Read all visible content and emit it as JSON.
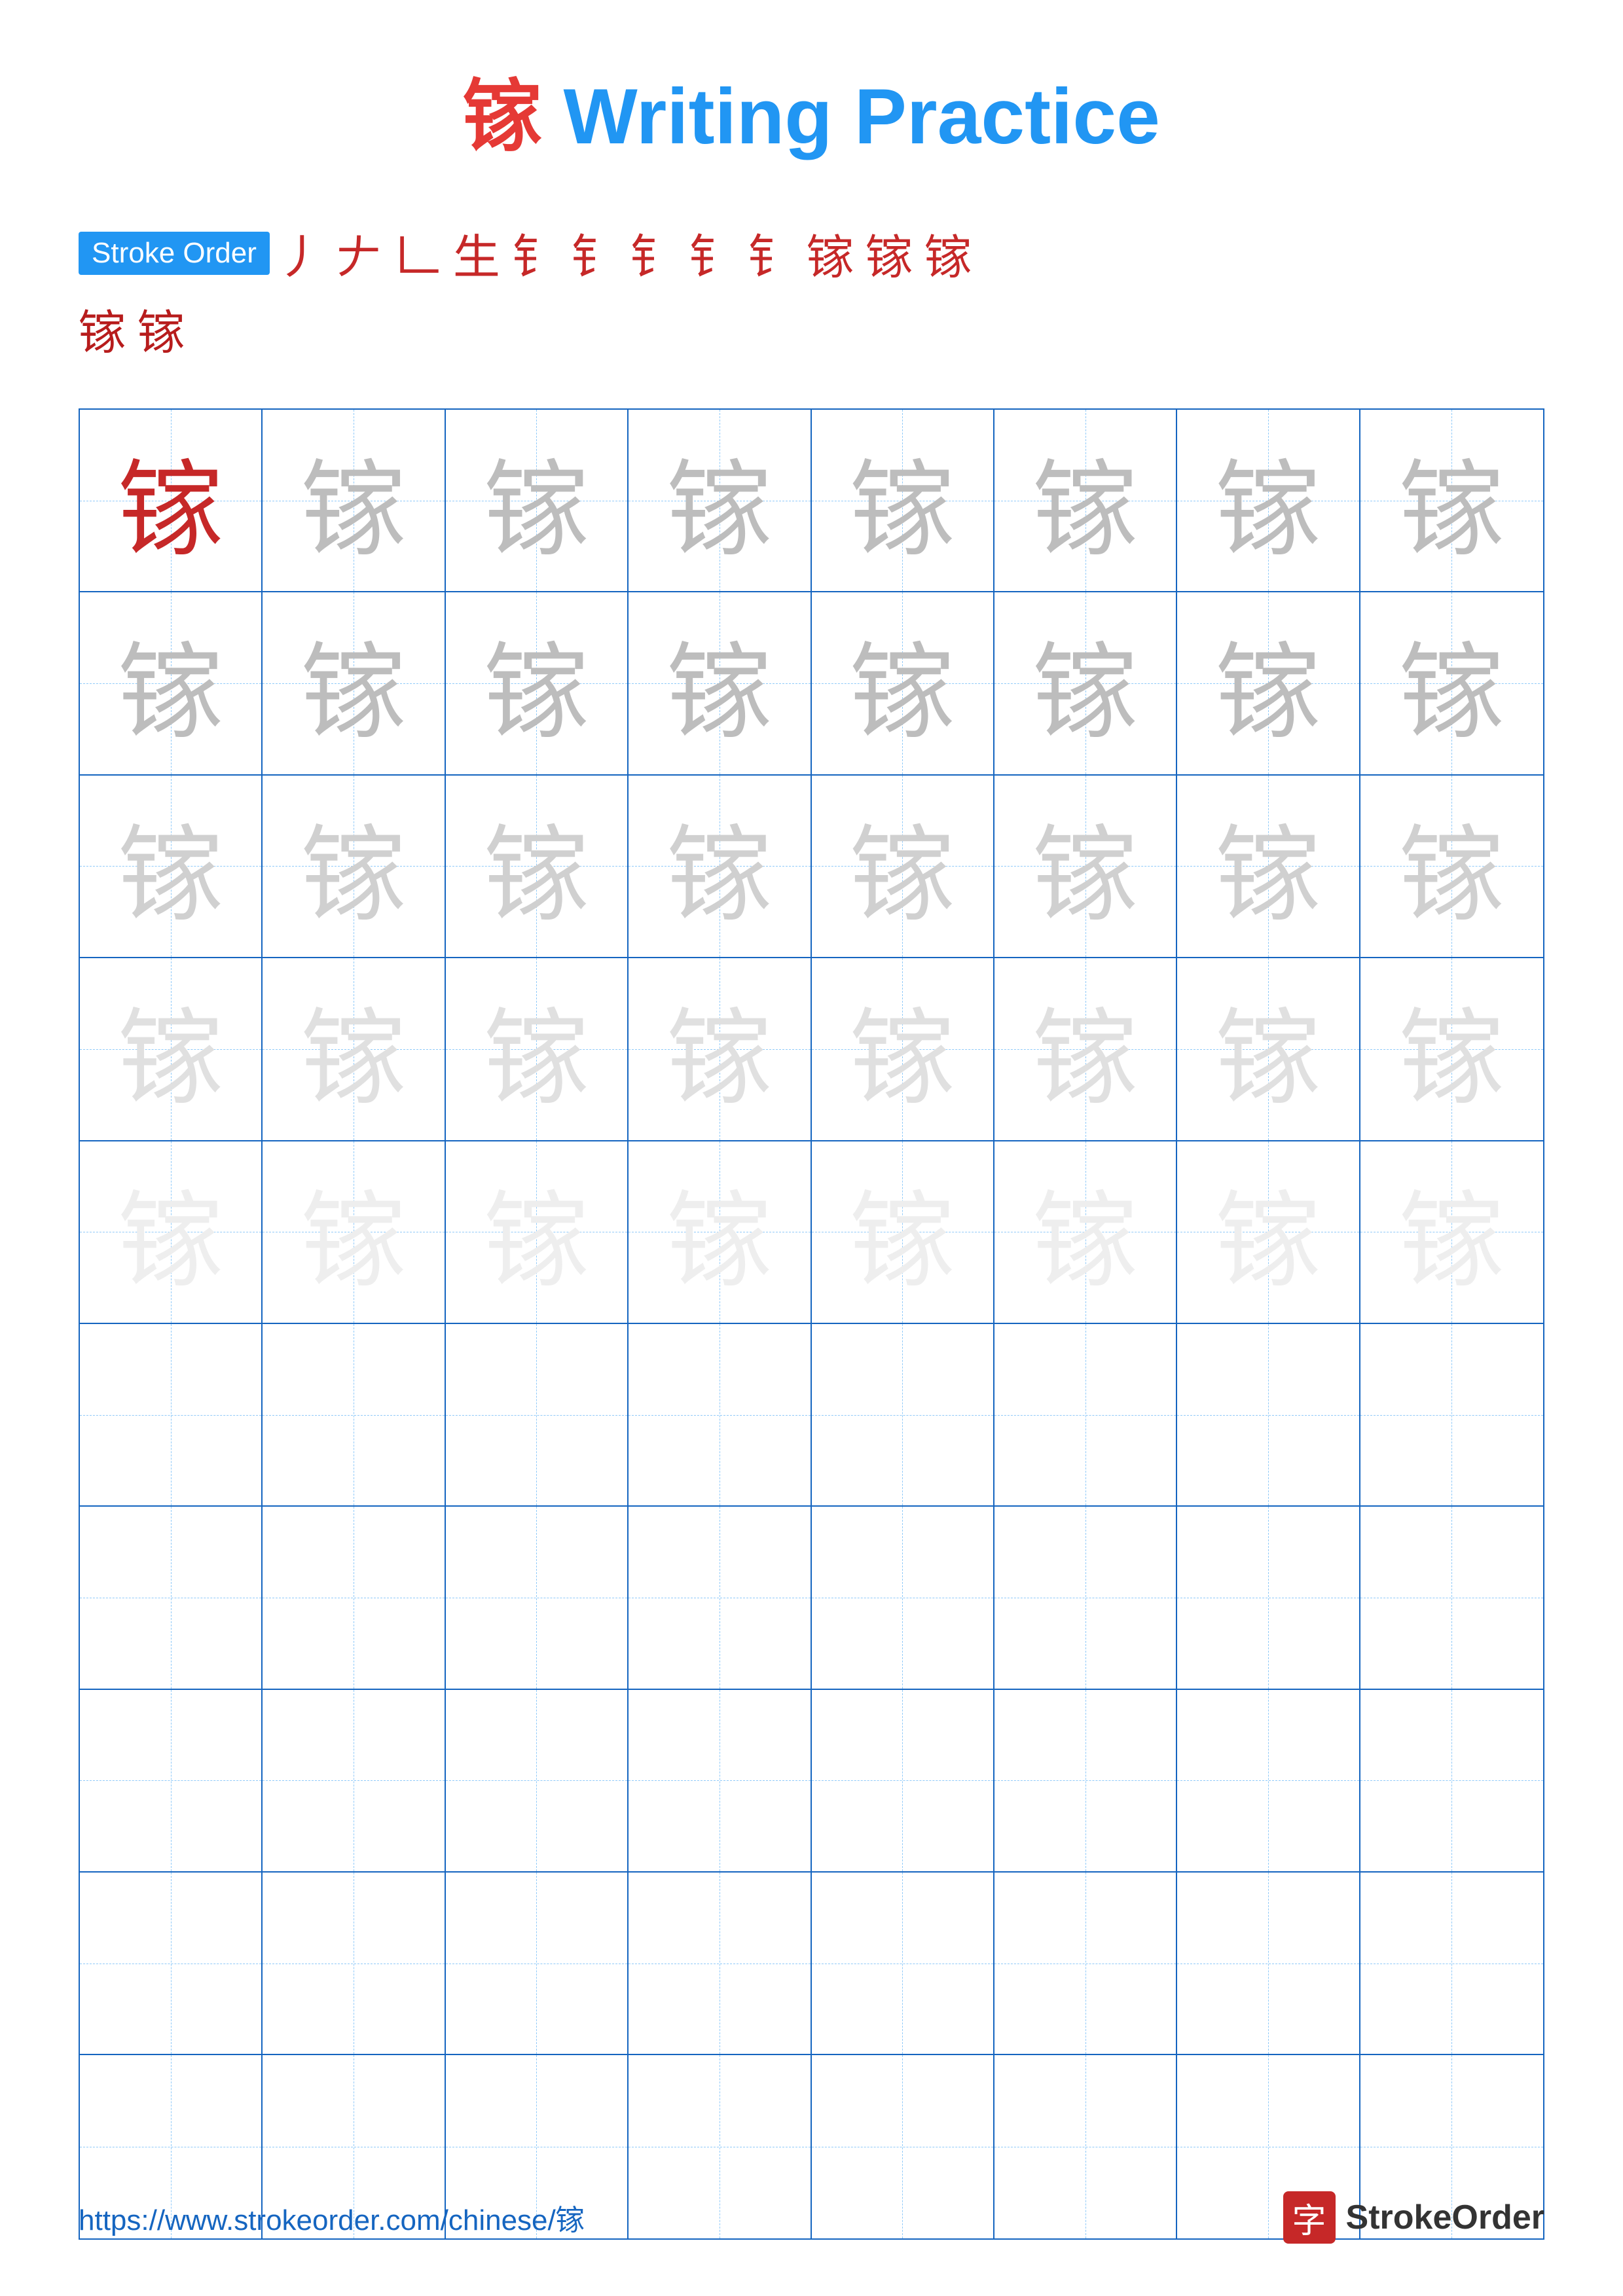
{
  "title": {
    "char": "镓",
    "label": "Writing Practice",
    "full": "镓 Writing Practice"
  },
  "stroke_order": {
    "badge_label": "Stroke Order",
    "strokes_row1": [
      "丿",
      "𠂇",
      "𠃊",
      "生",
      "钅",
      "钅̣",
      "钅̈",
      "钅͘",
      "钅̀",
      "镓̀",
      "镓̈",
      "镓"
    ],
    "strokes_row2": [
      "镓",
      "镓"
    ],
    "stroke_chars_row1": [
      "丿",
      "十",
      "𠃊",
      "生",
      "钅",
      "钅",
      "钅",
      "钅",
      "钅",
      "镓",
      "镓",
      "镓"
    ],
    "stroke_chars_row2": [
      "镓",
      "镓"
    ]
  },
  "practice_char": "镓",
  "grid": {
    "cols": 8,
    "rows": 10,
    "char_rows": 5,
    "empty_rows": 5
  },
  "footer": {
    "url": "https://www.strokeorder.com/chinese/镓",
    "logo_char": "字",
    "logo_text": "StrokeOrder"
  },
  "colors": {
    "blue": "#1565c0",
    "light_blue": "#2196F3",
    "red": "#c62828",
    "gray1": "#bdbdbd",
    "gray2": "#d0d0d0",
    "gray3": "#e0e0e0",
    "gray4": "#eeeeee"
  }
}
